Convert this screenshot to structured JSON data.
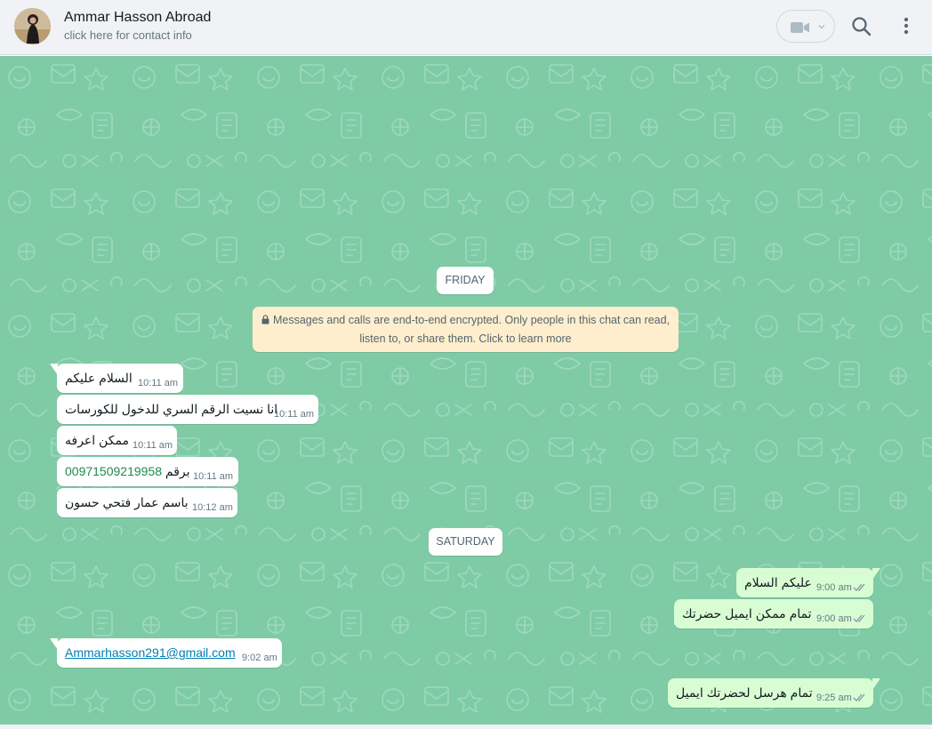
{
  "header": {
    "contact_name": "Ammar Hasson Abroad",
    "contact_subtitle": "click here for contact info"
  },
  "icons": {
    "video": "video-camera-icon",
    "search": "search-icon",
    "menu": "menu-dots-icon",
    "lock": "lock-icon"
  },
  "colors": {
    "header_bg": "#f0f2f5",
    "chat_bg": "#7fcba6",
    "incoming_bubble": "#ffffff",
    "outgoing_bubble": "#d9fdd3",
    "notice_bg": "#ffeecd",
    "link": "#027eb5",
    "ticks": "#8696a0"
  },
  "chat": {
    "date_friday": "FRIDAY",
    "encryption_line1": "Messages and calls are end-to-end encrypted. Only people in this chat can read,",
    "encryption_line2": "listen to, or share them. Click to learn more",
    "date_saturday": "SATURDAY",
    "messages": [
      {
        "direction": "in",
        "text": "السلام عليكم",
        "time": "10:11 am"
      },
      {
        "direction": "in",
        "text": "انا نسيت الرقم السري للدخول للكورسات",
        "time": "10:11 am"
      },
      {
        "direction": "in",
        "text": "ممكن اعرفه",
        "time": "10:11 am"
      },
      {
        "direction": "in",
        "text_prefix": "برقم",
        "phone": "00971509219958",
        "time": "10:11 am"
      },
      {
        "direction": "in",
        "text": "باسم عمار فتحي حسون",
        "time": "10:12 am"
      },
      {
        "direction": "out",
        "text": "عليكم السلام",
        "time": "9:00 am",
        "status": "read"
      },
      {
        "direction": "out",
        "text": "تمام ممكن ايميل حضرتك",
        "time": "9:00 am",
        "status": "read"
      },
      {
        "direction": "in",
        "email": "Ammarhasson291@gmail.com",
        "time": "9:02 am"
      },
      {
        "direction": "out",
        "text": "تمام هرسل لحضرتك ايميل",
        "time": "9:25 am",
        "status": "read"
      }
    ]
  }
}
